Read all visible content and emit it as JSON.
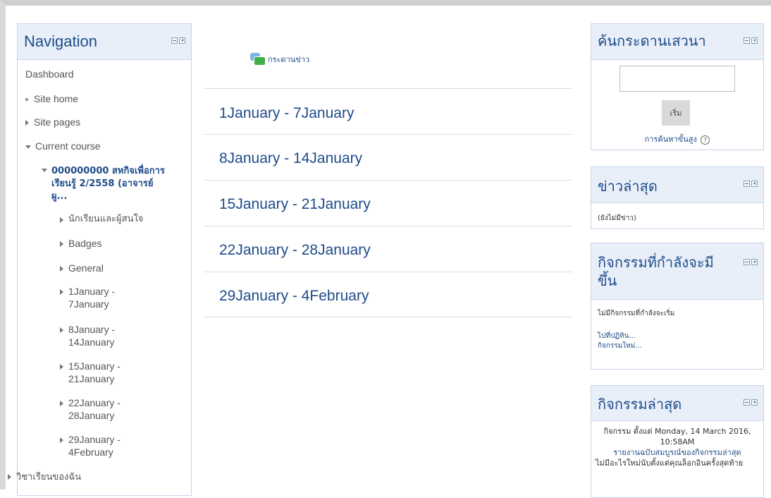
{
  "navigation": {
    "title": "Navigation",
    "dashboard": "Dashboard",
    "site_home": "Site home",
    "site_pages": "Site pages",
    "current_course": "Current course",
    "course_name": "000000000 สหกิจเพื่อการเรียนรู้ 2/2558 (อาจารย์ ผู...",
    "sections": [
      "นักเรียนและผู้สนใจ",
      "Badges",
      "General",
      "1January - 7January",
      "8January - 14January",
      "15January - 21January",
      "22January - 28January",
      "29January - 4February"
    ],
    "my_courses": "วิชาเรียนของฉัน"
  },
  "main": {
    "news_forum": "กระดานข่าว",
    "weeks": [
      "1January - 7January",
      "8January - 14January",
      "15January - 21January",
      "22January - 28January",
      "29January - 4February"
    ]
  },
  "search_forums": {
    "title": "ค้นกระดานเสวนา",
    "input_value": "",
    "go_label": "เริ่ม",
    "advanced": "การค้นหาขั้นสูง",
    "help": "?"
  },
  "latest_news": {
    "title": "ข่าวล่าสุด",
    "empty": "(ยังไม่มีข่าว)"
  },
  "upcoming": {
    "title": "กิจกรรมที่กำลังจะมีขึ้น",
    "empty": "ไม่มีกิจกรรมที่กำลังจะเริ่ม",
    "goto_calendar": "ไปที่ปฏิทิน...",
    "new_event": "กิจกรรมใหม่..."
  },
  "recent_activity": {
    "title": "กิจกรรมล่าสุด",
    "since": "กิจกรรม ตั้งแต่ Monday, 14 March 2016, 10:58AM",
    "full_report": "รายงานฉบับสมบูรณ์ของกิจกรรมล่าสุด",
    "nothing_new": "ไม่มีอะไรใหม่นับตั้งแต่คุณล็อกอินครั้งสุดท้าย"
  }
}
